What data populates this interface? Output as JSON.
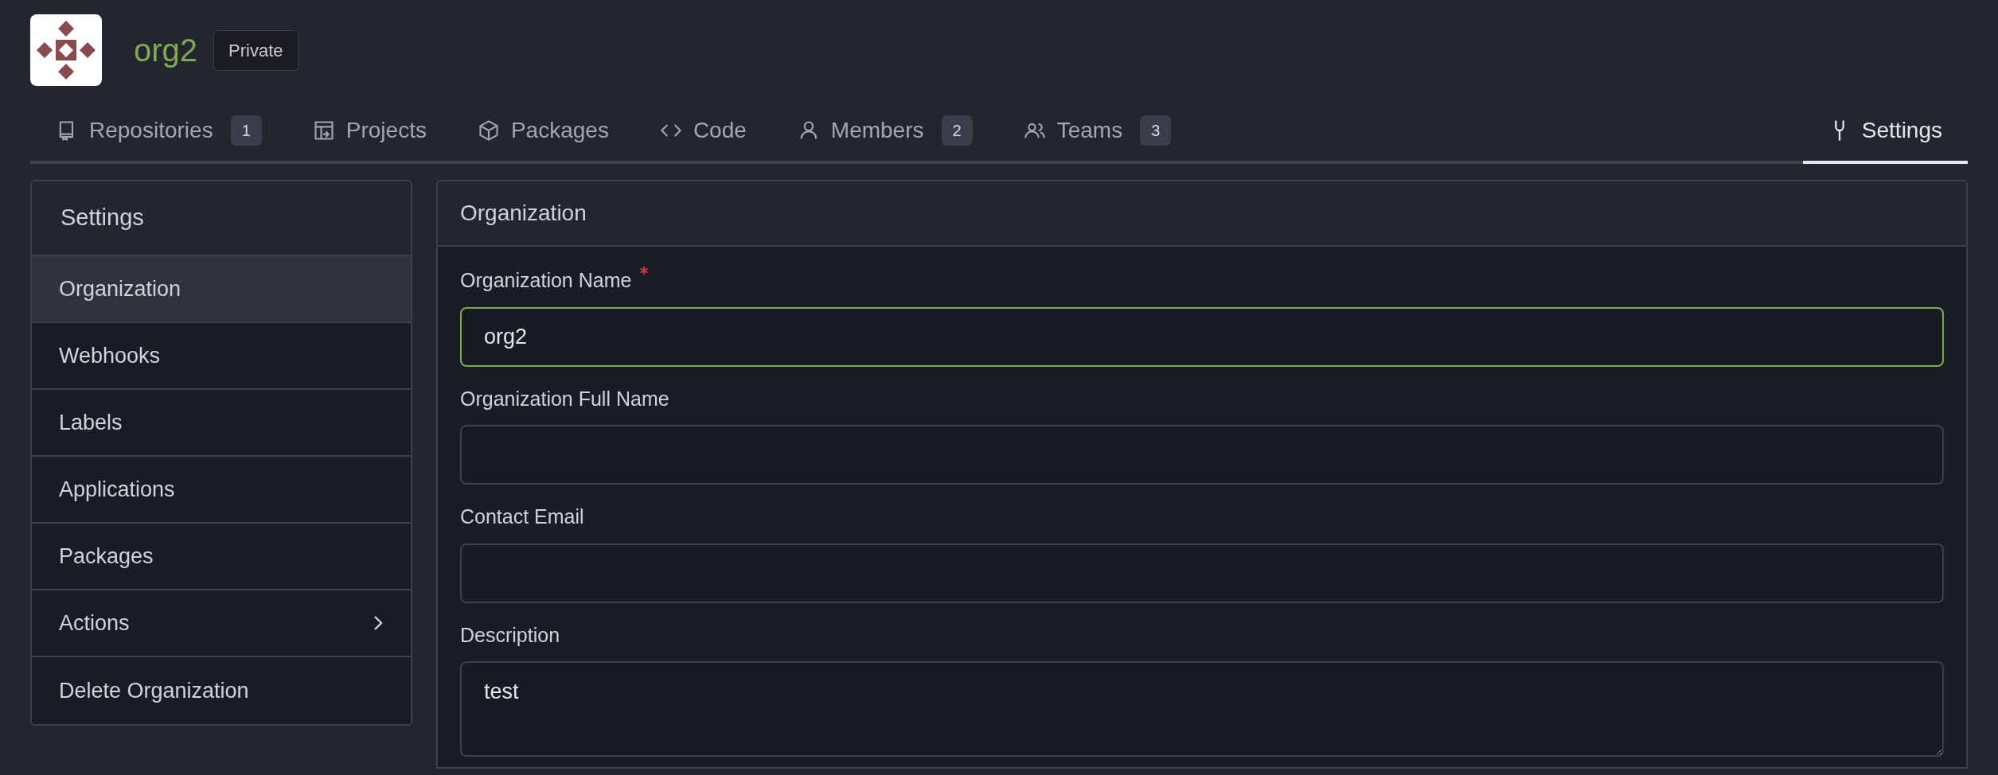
{
  "org": {
    "name": "org2",
    "visibility": "Private"
  },
  "tabs": [
    {
      "label": "Repositories",
      "count": "1",
      "selected": false
    },
    {
      "label": "Projects",
      "selected": false
    },
    {
      "label": "Packages",
      "selected": false
    },
    {
      "label": "Code",
      "selected": false
    },
    {
      "label": "Members",
      "count": "2",
      "selected": false
    },
    {
      "label": "Teams",
      "count": "3",
      "selected": false
    },
    {
      "label": "Settings",
      "selected": true
    }
  ],
  "sidebar": {
    "title": "Settings",
    "items": [
      {
        "label": "Organization",
        "selected": true,
        "expandable": false
      },
      {
        "label": "Webhooks",
        "selected": false,
        "expandable": false
      },
      {
        "label": "Labels",
        "selected": false,
        "expandable": false
      },
      {
        "label": "Applications",
        "selected": false,
        "expandable": false
      },
      {
        "label": "Packages",
        "selected": false,
        "expandable": false
      },
      {
        "label": "Actions",
        "selected": false,
        "expandable": true
      },
      {
        "label": "Delete Organization",
        "selected": false,
        "expandable": false
      }
    ]
  },
  "panel": {
    "title": "Organization",
    "fields": [
      {
        "kind": "input",
        "label": "Organization Name",
        "required": true,
        "focused": true,
        "value": "org2"
      },
      {
        "kind": "input",
        "label": "Organization Full Name",
        "required": false,
        "focused": false
      },
      {
        "kind": "input",
        "label": "Contact Email",
        "required": false,
        "focused": false
      },
      {
        "kind": "textarea",
        "label": "Description",
        "required": false,
        "focused": false,
        "value": "test"
      }
    ]
  }
}
